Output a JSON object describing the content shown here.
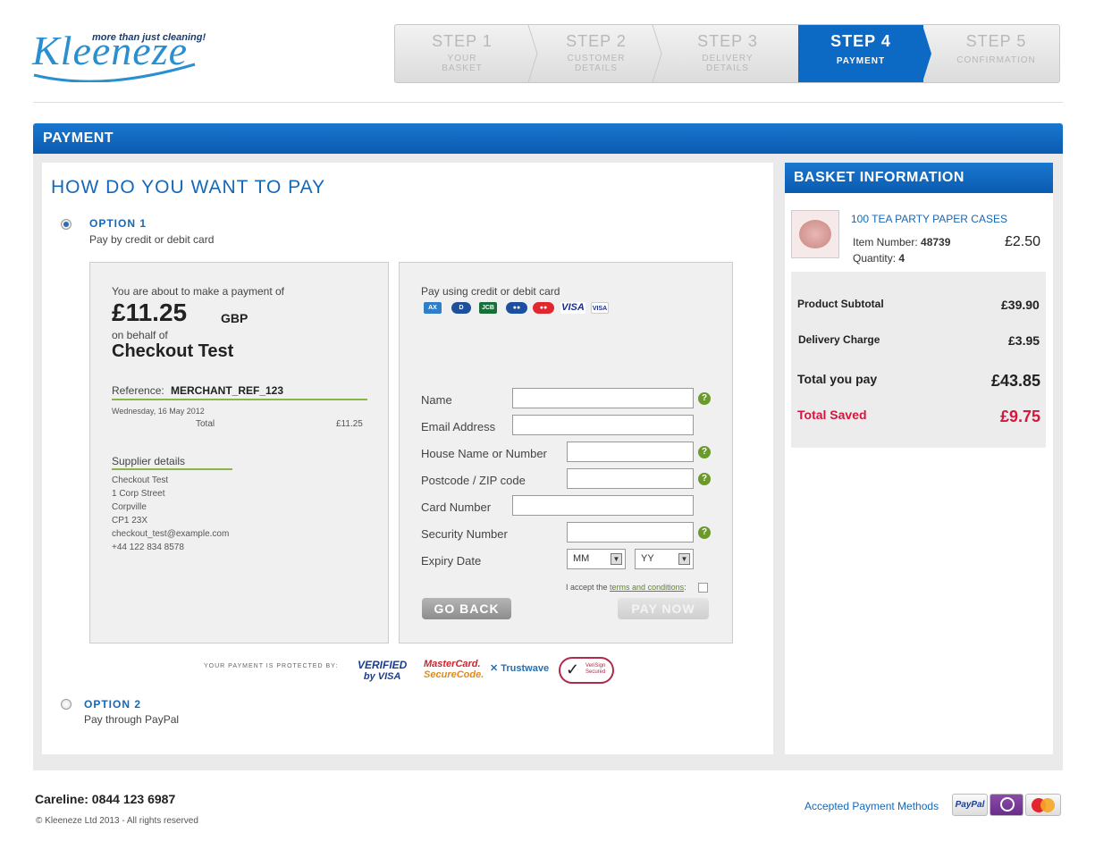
{
  "header": {
    "logo_word": "Kleeneze",
    "logo_tagline": "more than just cleaning!",
    "steps": [
      {
        "num": "STEP 1",
        "sub1": "YOUR",
        "sub2": "BASKET"
      },
      {
        "num": "STEP 2",
        "sub1": "CUSTOMER",
        "sub2": "DETAILS"
      },
      {
        "num": "STEP 3",
        "sub1": "DELIVERY",
        "sub2": "DETAILS"
      },
      {
        "num": "STEP 4",
        "sub1": "PAYMENT",
        "sub2": ""
      },
      {
        "num": "STEP 5",
        "sub1": "CONFIRMATION",
        "sub2": ""
      }
    ],
    "active_step": 4,
    "accent_color": "#0d6ac4"
  },
  "panel": {
    "title": "PAYMENT",
    "heading": "HOW DO YOU WANT TO PAY",
    "option1": {
      "title": "OPTION 1",
      "subtitle": "Pay by credit or debit card",
      "selected": true
    },
    "option2": {
      "title": "OPTION 2",
      "subtitle": "Pay through PayPal",
      "selected": false
    }
  },
  "summary": {
    "intro": "You are about to make a payment of",
    "amount": "£11.25",
    "currency": "GBP",
    "on_behalf": "on behalf of",
    "merchant": "Checkout Test",
    "reference_label": "Reference:",
    "reference_value": "MERCHANT_REF_123",
    "date": "Wednesday, 16 May 2012",
    "total_label": "Total",
    "total_value": "£11.25",
    "supplier_heading": "Supplier details",
    "supplier_lines": [
      "Checkout Test",
      "1 Corp Street",
      "Corpville",
      "CP1 23X",
      "checkout_test@example.com",
      "+44 122 834 8578"
    ]
  },
  "card_form": {
    "heading": "Pay using credit or debit card",
    "card_brands": [
      "AMEX",
      "DINERS",
      "JCB",
      "MAESTRO",
      "MASTERCARD",
      "VISA",
      "VISA ELECTRON"
    ],
    "fields": {
      "name": {
        "label": "Name",
        "value": ""
      },
      "email": {
        "label": "Email Address",
        "value": ""
      },
      "house": {
        "label": "House Name or Number",
        "value": ""
      },
      "postcode": {
        "label": "Postcode / ZIP code",
        "value": ""
      },
      "card_number": {
        "label": "Card Number",
        "value": ""
      },
      "security": {
        "label": "Security Number",
        "value": ""
      },
      "expiry": {
        "label": "Expiry Date",
        "month": "MM",
        "year": "YY"
      }
    },
    "terms_prefix": "I accept the",
    "terms_link": "terms and conditions",
    "terms_suffix": ":",
    "go_back": "GO BACK",
    "pay_now": "PAY NOW"
  },
  "protection": {
    "label": "YOUR PAYMENT IS PROTECTED BY:",
    "verified": "VERIFIED",
    "by_visa": "by VISA",
    "mc_line1": "MasterCard.",
    "mc_line2": "SecureCode.",
    "trustwave": "Trustwave",
    "verisign": "VeriSign Secured"
  },
  "basket": {
    "title": "BASKET INFORMATION",
    "item_name": "100 TEA PARTY PAPER CASES",
    "item_number_label": "Item Number:",
    "item_number": "48739",
    "quantity_label": "Quantity:",
    "quantity": "4",
    "item_price": "£2.50",
    "subtotal_label": "Product Subtotal",
    "subtotal": "£39.90",
    "delivery_label": "Delivery Charge",
    "delivery": "£3.95",
    "total_label": "Total you pay",
    "total": "£43.85",
    "saved_label": "Total Saved",
    "saved": "£9.75",
    "saved_color": "#d8153d"
  },
  "footer": {
    "careline": "Careline: 0844 123 6987",
    "copyright": "© Kleeneze Ltd 2013 - All rights reserved",
    "accepted": "Accepted Payment Methods",
    "methods": [
      "PayPal",
      "Solo",
      "MasterCard"
    ]
  }
}
